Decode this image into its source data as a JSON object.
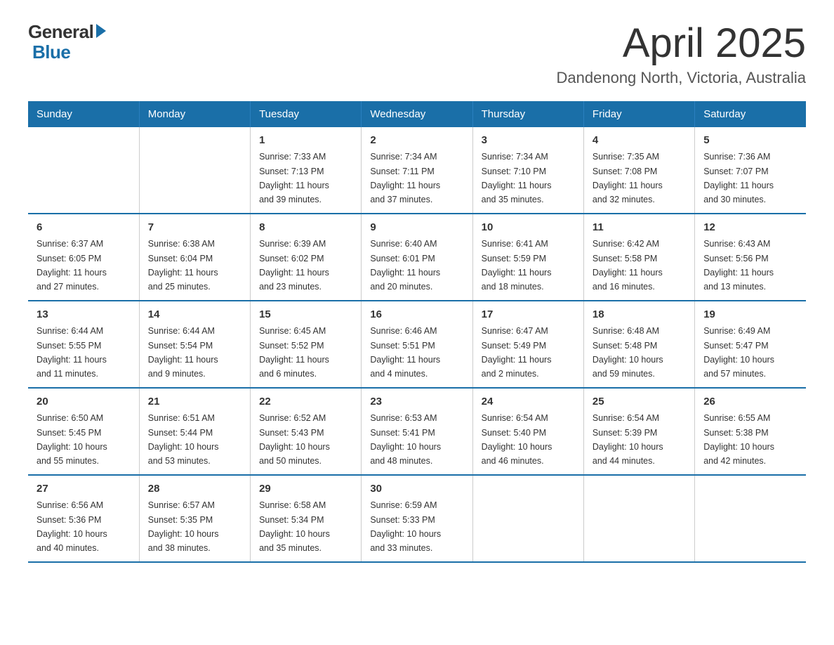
{
  "header": {
    "logo": {
      "general": "General",
      "blue": "Blue"
    },
    "title": "April 2025",
    "location": "Dandenong North, Victoria, Australia"
  },
  "calendar": {
    "days_of_week": [
      "Sunday",
      "Monday",
      "Tuesday",
      "Wednesday",
      "Thursday",
      "Friday",
      "Saturday"
    ],
    "weeks": [
      [
        {
          "day": "",
          "info": ""
        },
        {
          "day": "",
          "info": ""
        },
        {
          "day": "1",
          "info": "Sunrise: 7:33 AM\nSunset: 7:13 PM\nDaylight: 11 hours\nand 39 minutes."
        },
        {
          "day": "2",
          "info": "Sunrise: 7:34 AM\nSunset: 7:11 PM\nDaylight: 11 hours\nand 37 minutes."
        },
        {
          "day": "3",
          "info": "Sunrise: 7:34 AM\nSunset: 7:10 PM\nDaylight: 11 hours\nand 35 minutes."
        },
        {
          "day": "4",
          "info": "Sunrise: 7:35 AM\nSunset: 7:08 PM\nDaylight: 11 hours\nand 32 minutes."
        },
        {
          "day": "5",
          "info": "Sunrise: 7:36 AM\nSunset: 7:07 PM\nDaylight: 11 hours\nand 30 minutes."
        }
      ],
      [
        {
          "day": "6",
          "info": "Sunrise: 6:37 AM\nSunset: 6:05 PM\nDaylight: 11 hours\nand 27 minutes."
        },
        {
          "day": "7",
          "info": "Sunrise: 6:38 AM\nSunset: 6:04 PM\nDaylight: 11 hours\nand 25 minutes."
        },
        {
          "day": "8",
          "info": "Sunrise: 6:39 AM\nSunset: 6:02 PM\nDaylight: 11 hours\nand 23 minutes."
        },
        {
          "day": "9",
          "info": "Sunrise: 6:40 AM\nSunset: 6:01 PM\nDaylight: 11 hours\nand 20 minutes."
        },
        {
          "day": "10",
          "info": "Sunrise: 6:41 AM\nSunset: 5:59 PM\nDaylight: 11 hours\nand 18 minutes."
        },
        {
          "day": "11",
          "info": "Sunrise: 6:42 AM\nSunset: 5:58 PM\nDaylight: 11 hours\nand 16 minutes."
        },
        {
          "day": "12",
          "info": "Sunrise: 6:43 AM\nSunset: 5:56 PM\nDaylight: 11 hours\nand 13 minutes."
        }
      ],
      [
        {
          "day": "13",
          "info": "Sunrise: 6:44 AM\nSunset: 5:55 PM\nDaylight: 11 hours\nand 11 minutes."
        },
        {
          "day": "14",
          "info": "Sunrise: 6:44 AM\nSunset: 5:54 PM\nDaylight: 11 hours\nand 9 minutes."
        },
        {
          "day": "15",
          "info": "Sunrise: 6:45 AM\nSunset: 5:52 PM\nDaylight: 11 hours\nand 6 minutes."
        },
        {
          "day": "16",
          "info": "Sunrise: 6:46 AM\nSunset: 5:51 PM\nDaylight: 11 hours\nand 4 minutes."
        },
        {
          "day": "17",
          "info": "Sunrise: 6:47 AM\nSunset: 5:49 PM\nDaylight: 11 hours\nand 2 minutes."
        },
        {
          "day": "18",
          "info": "Sunrise: 6:48 AM\nSunset: 5:48 PM\nDaylight: 10 hours\nand 59 minutes."
        },
        {
          "day": "19",
          "info": "Sunrise: 6:49 AM\nSunset: 5:47 PM\nDaylight: 10 hours\nand 57 minutes."
        }
      ],
      [
        {
          "day": "20",
          "info": "Sunrise: 6:50 AM\nSunset: 5:45 PM\nDaylight: 10 hours\nand 55 minutes."
        },
        {
          "day": "21",
          "info": "Sunrise: 6:51 AM\nSunset: 5:44 PM\nDaylight: 10 hours\nand 53 minutes."
        },
        {
          "day": "22",
          "info": "Sunrise: 6:52 AM\nSunset: 5:43 PM\nDaylight: 10 hours\nand 50 minutes."
        },
        {
          "day": "23",
          "info": "Sunrise: 6:53 AM\nSunset: 5:41 PM\nDaylight: 10 hours\nand 48 minutes."
        },
        {
          "day": "24",
          "info": "Sunrise: 6:54 AM\nSunset: 5:40 PM\nDaylight: 10 hours\nand 46 minutes."
        },
        {
          "day": "25",
          "info": "Sunrise: 6:54 AM\nSunset: 5:39 PM\nDaylight: 10 hours\nand 44 minutes."
        },
        {
          "day": "26",
          "info": "Sunrise: 6:55 AM\nSunset: 5:38 PM\nDaylight: 10 hours\nand 42 minutes."
        }
      ],
      [
        {
          "day": "27",
          "info": "Sunrise: 6:56 AM\nSunset: 5:36 PM\nDaylight: 10 hours\nand 40 minutes."
        },
        {
          "day": "28",
          "info": "Sunrise: 6:57 AM\nSunset: 5:35 PM\nDaylight: 10 hours\nand 38 minutes."
        },
        {
          "day": "29",
          "info": "Sunrise: 6:58 AM\nSunset: 5:34 PM\nDaylight: 10 hours\nand 35 minutes."
        },
        {
          "day": "30",
          "info": "Sunrise: 6:59 AM\nSunset: 5:33 PM\nDaylight: 10 hours\nand 33 minutes."
        },
        {
          "day": "",
          "info": ""
        },
        {
          "day": "",
          "info": ""
        },
        {
          "day": "",
          "info": ""
        }
      ]
    ]
  }
}
